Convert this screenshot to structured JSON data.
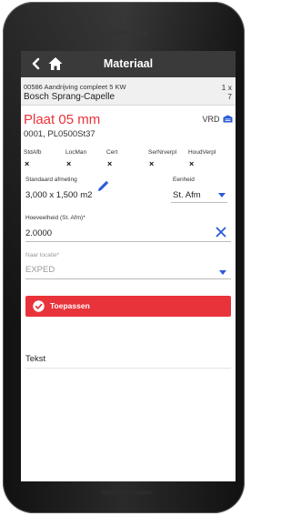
{
  "appbar": {
    "title": "Materiaal",
    "back_icon": "chevron-left-icon",
    "home_icon": "home-icon"
  },
  "order": {
    "line1": "00586 Aandrijving compleet 5 KW",
    "line2": "Bosch Sprang-Capelle",
    "qty_top": "1 x",
    "qty_bottom": "7"
  },
  "item": {
    "title": "Plaat 05 mm",
    "code": "0001, PL0500St37",
    "vrd_label": "VRD",
    "vrd_icon": "warehouse-icon"
  },
  "flags": [
    {
      "label": "StdAfb",
      "value": "×"
    },
    {
      "label": "LocMan",
      "value": "×"
    },
    {
      "label": "Cert",
      "value": "×"
    },
    {
      "label": "SerNrverpl",
      "value": "×"
    },
    {
      "label": "HoudVerpl",
      "value": "×"
    }
  ],
  "dimension": {
    "label": "Standaard afmeting",
    "value": "3,000 x 1,500 m2",
    "edit_icon": "pencil-icon"
  },
  "unit": {
    "label": "Eenheid",
    "value": "St. Afm"
  },
  "quantity": {
    "label": "Hoeveelheid (St. Afm)*",
    "value": "2.0000",
    "clear_icon": "close-icon"
  },
  "location": {
    "label": "Naar locatie*",
    "value": "EXPED"
  },
  "apply_button": {
    "label": "Toepassen",
    "icon": "check-circle-icon"
  },
  "text_section": {
    "label": "Tekst"
  },
  "colors": {
    "accent": "#e8333a",
    "appbar": "#3a3a3a",
    "link": "#2a5bd7"
  }
}
